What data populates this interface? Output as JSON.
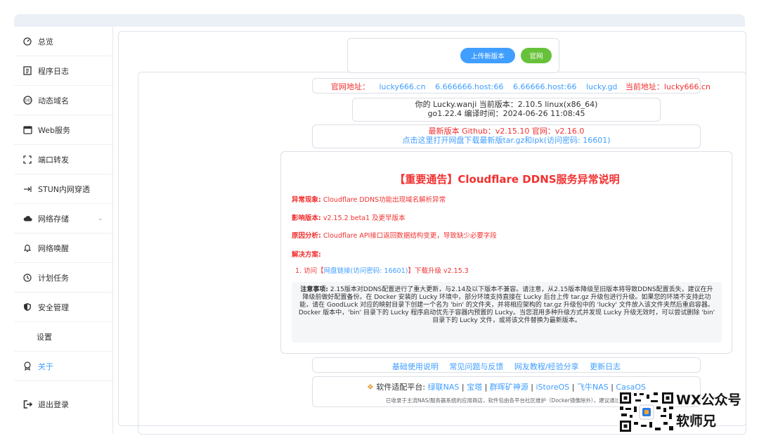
{
  "sidebar": {
    "items": [
      {
        "label": "总览",
        "icon": "dashboard-icon"
      },
      {
        "label": "程序日志",
        "icon": "log-icon"
      },
      {
        "label": "动态域名",
        "icon": "ddns-icon"
      },
      {
        "label": "Web服务",
        "icon": "web-icon"
      },
      {
        "label": "端口转发",
        "icon": "port-forward-icon"
      },
      {
        "label": "STUN内网穿透",
        "icon": "stun-icon"
      },
      {
        "label": "网络存储",
        "icon": "cloud-icon"
      },
      {
        "label": "网络唤醒",
        "icon": "bell-icon"
      },
      {
        "label": "计划任务",
        "icon": "clock-icon"
      },
      {
        "label": "安全管理",
        "icon": "shield-icon"
      },
      {
        "label": "设置",
        "icon": ""
      },
      {
        "label": "关于",
        "icon": "about-icon"
      },
      {
        "label": "退出登录",
        "icon": "logout-icon"
      }
    ]
  },
  "upload": {
    "upload_label": "上传新版本",
    "site_label": "官网"
  },
  "site_row": {
    "label": "官网地址：",
    "links": [
      "lucky666.cn",
      "6.666666.host:66",
      "6.66666.host:66",
      "lucky.gd"
    ],
    "current_label": "当前地址：",
    "current": "lucky666.cn"
  },
  "version_info": {
    "line1": "你的 Lucky.wanji   当前版本：2.10.5 linux(x86_64)",
    "line2": "go1.22.4   编译时间：2024-06-26 11:08:45"
  },
  "latest": {
    "line1": "最新版本   Github：v2.15.10   官网：v2.16.0",
    "line2": "点击这里打开网盘下载最新版tar.gz和ipk(访问密码: 16601)"
  },
  "notice": {
    "title": "【重要通告】Cloudflare DDNS服务异常说明",
    "symptom_label": "异常现象:",
    "symptom": " Cloudflare DDNS功能出现域名解析异常",
    "affected_label": "影响版本:",
    "affected": " v2.15.2 beta1 及更早版本",
    "cause_label": "原因分析:",
    "cause": " Cloudflare API接口返回数据结构变更，导致缺少必要字段",
    "solution_label": "解决方案:",
    "step_prefix": "1. 访问【",
    "step_link": "网盘链接(访问密码: 16601)",
    "step_suffix": "】下载升级 v2.15.3",
    "caution_label": "注意事项:",
    "caution_text": " 2.15版本对DDNS配置进行了重大更新，与2.14及以下版本不兼容。请注意，从2.15版本降级至旧版本将导致DDNS配置丢失，建议在升降级前做好配置备份。在 Docker 安装的 Lucky 环境中，部分环境支持直接在 Lucky 后台上传 tar.gz 升级包进行升级。如果您的环境不支持此功能，请在 GoodLuck 对应的映射目录下创建一个名为 'bin' 的文件夹，并将相应架构的 tar.gz 升级包中的 'lucky' 文件放入该文件夹然后重启容器。Docker 版本中，'bin' 目录下的 Lucky 程序启动优先于容器内预置的 Lucky。当您混用多种升级方式并发现 Lucky 升级无效时，可以尝试删除 'bin' 目录下的 Lucky 文件，或将该文件替换为最新版本。"
  },
  "footer_links": [
    "基础使用说明",
    "常见问题与反馈",
    "网友教程/经验分享",
    "更新日志"
  ],
  "platforms": {
    "title": "软件适配平台:",
    "items": [
      "绿联NAS",
      "宝塔",
      "群晖矿神源",
      "iStoreOS",
      "飞牛NAS",
      "CasaOS"
    ],
    "note": "已收录于主流NAS/服务器系统的应用商店，软件包由各平台社区维护（Docker镜像除外），建议通过 官"
  },
  "watermark": {
    "line1": "WX公众号",
    "line2": "软师兄"
  },
  "colors": {
    "accent": "#409eff",
    "danger": "#f23030",
    "success": "#67c23a"
  }
}
